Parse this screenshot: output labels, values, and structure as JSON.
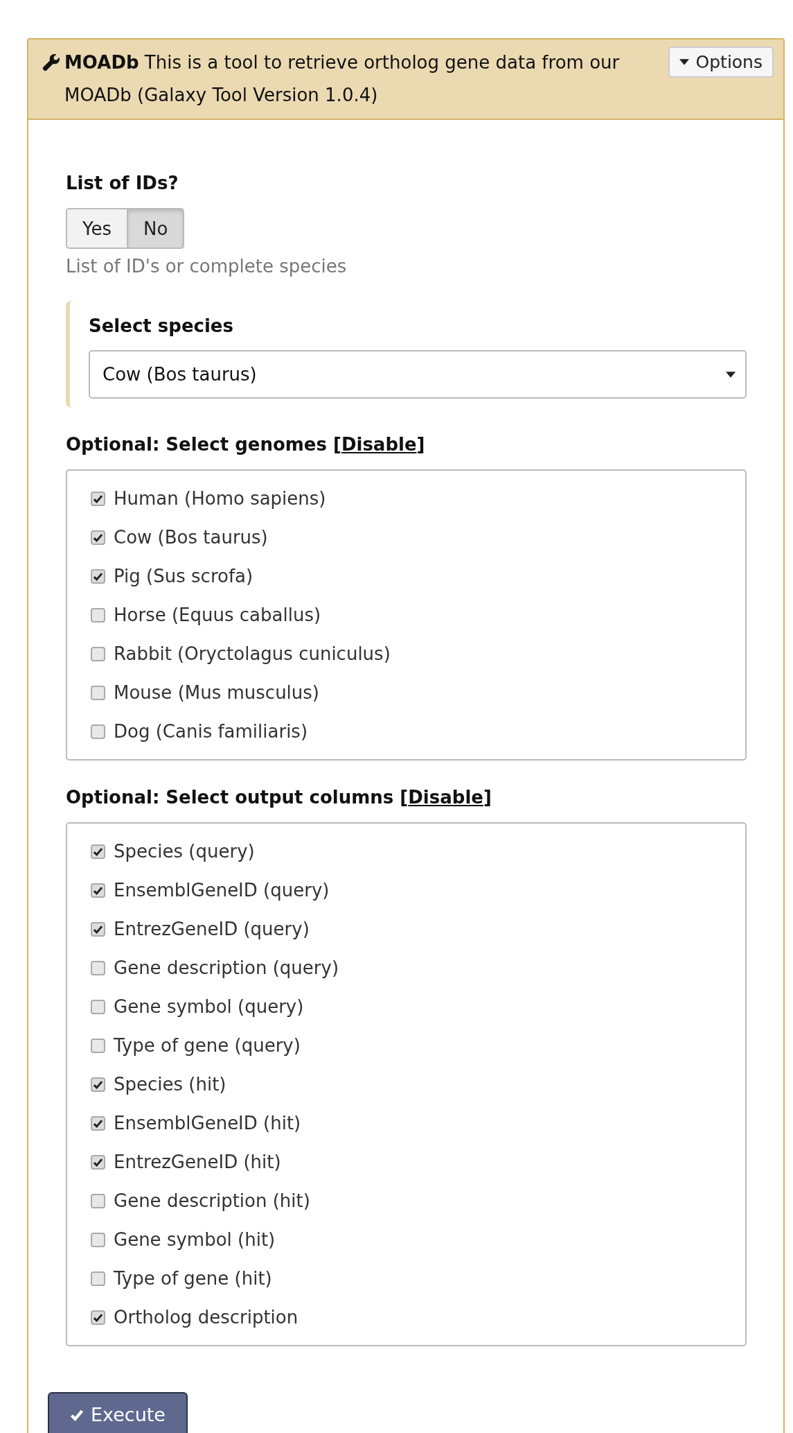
{
  "header": {
    "text": "**MOADb** This is a tool to retrieve ortholog gene data from our MOADb (Galaxy Tool Version 1.0.4)",
    "options_button": "Options"
  },
  "list_of_ids": {
    "label": "List of IDs?",
    "options": [
      {
        "label": "Yes",
        "selected": false
      },
      {
        "label": "No",
        "selected": true
      }
    ],
    "hint": "List of ID's or complete species"
  },
  "species": {
    "label": "Select species",
    "value": "Cow (Bos taurus)"
  },
  "genomes": {
    "label": "Optional: Select genomes [",
    "link": "Disable",
    "label_end": "]",
    "items": [
      {
        "label": "Human (Homo sapiens)",
        "checked": true
      },
      {
        "label": "Cow (Bos taurus)",
        "checked": true
      },
      {
        "label": "Pig (Sus scrofa)",
        "checked": true
      },
      {
        "label": "Horse (Equus caballus)",
        "checked": false
      },
      {
        "label": "Rabbit (Oryctolagus cuniculus)",
        "checked": false
      },
      {
        "label": "Mouse (Mus musculus)",
        "checked": false
      },
      {
        "label": "Dog (Canis familiaris)",
        "checked": false
      }
    ]
  },
  "output_columns": {
    "label": "Optional: Select output columns [",
    "link": "Disable",
    "label_end": "]",
    "items": [
      {
        "label": "Species (query)",
        "checked": true
      },
      {
        "label": "EnsemblGeneID (query)",
        "checked": true
      },
      {
        "label": "EntrezGeneID (query)",
        "checked": true
      },
      {
        "label": "Gene description (query)",
        "checked": false
      },
      {
        "label": "Gene symbol (query)",
        "checked": false
      },
      {
        "label": "Type of gene (query)",
        "checked": false
      },
      {
        "label": "Species (hit)",
        "checked": true
      },
      {
        "label": "EnsemblGeneID (hit)",
        "checked": true
      },
      {
        "label": "EntrezGeneID (hit)",
        "checked": true
      },
      {
        "label": "Gene description (hit)",
        "checked": false
      },
      {
        "label": "Gene symbol (hit)",
        "checked": false
      },
      {
        "label": "Type of gene (hit)",
        "checked": false
      },
      {
        "label": "Ortholog description",
        "checked": true
      }
    ]
  },
  "execute_button": "Execute"
}
